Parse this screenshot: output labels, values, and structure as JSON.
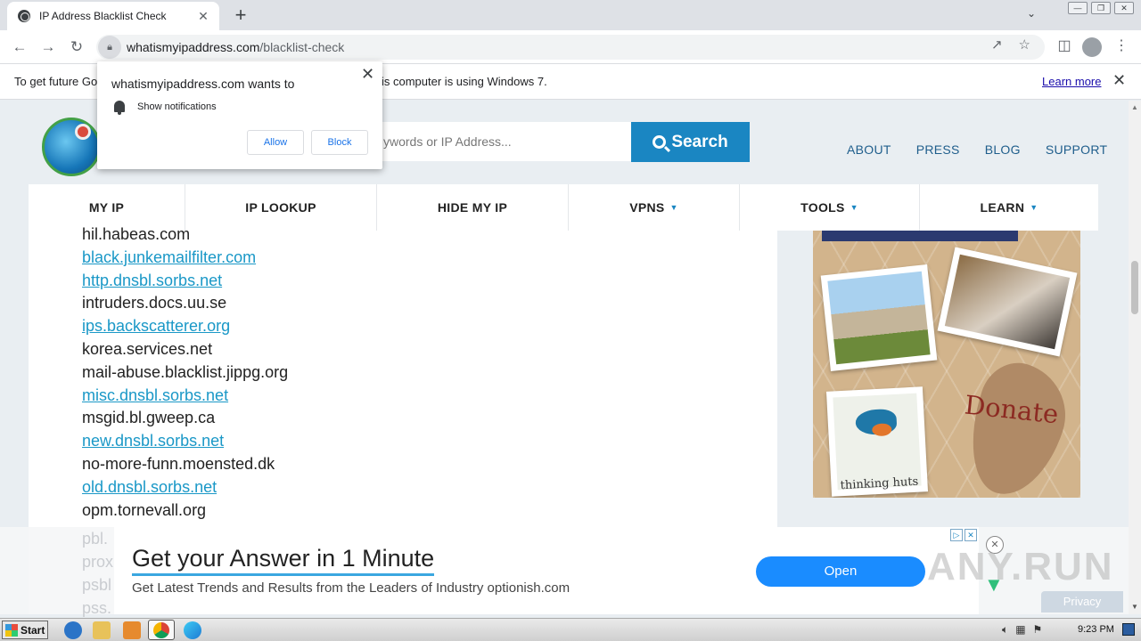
{
  "browser": {
    "tab_title": "IP Address Blacklist Check",
    "tab_close": "✕",
    "new_tab": "+",
    "url_host": "whatismyipaddress.com",
    "url_path": "/blacklist-check",
    "window_buttons": [
      "—",
      "❐",
      "✕"
    ]
  },
  "infobar": {
    "message_start": "To get future Go",
    "message_end": "is computer is using Windows 7.",
    "learn_more": "Learn more",
    "close": "✕"
  },
  "notification": {
    "origin": "whatismyipaddress.com wants to",
    "permission": "Show notifications",
    "allow": "Allow",
    "block": "Block",
    "close": "✕"
  },
  "header": {
    "search_placeholder": "ywords or IP Address...",
    "search_button": "Search",
    "top_nav": [
      "ABOUT",
      "PRESS",
      "BLOG",
      "SUPPORT"
    ]
  },
  "main_nav": [
    {
      "label": "MY IP",
      "dropdown": false
    },
    {
      "label": "IP LOOKUP",
      "dropdown": false
    },
    {
      "label": "HIDE MY IP",
      "dropdown": false
    },
    {
      "label": "VPNS",
      "dropdown": true
    },
    {
      "label": "TOOLS",
      "dropdown": true
    },
    {
      "label": "LEARN",
      "dropdown": true
    }
  ],
  "blacklists": [
    {
      "name": "hil.habeas.com",
      "link": false
    },
    {
      "name": "black.junkemailfilter.com",
      "link": true
    },
    {
      "name": "http.dnsbl.sorbs.net",
      "link": true
    },
    {
      "name": "intruders.docs.uu.se",
      "link": false
    },
    {
      "name": "ips.backscatterer.org",
      "link": true
    },
    {
      "name": "korea.services.net",
      "link": false
    },
    {
      "name": "mail-abuse.blacklist.jippg.org",
      "link": false
    },
    {
      "name": "misc.dnsbl.sorbs.net",
      "link": true
    },
    {
      "name": "msgid.bl.gweep.ca",
      "link": false
    },
    {
      "name": "new.dnsbl.sorbs.net",
      "link": true
    },
    {
      "name": "no-more-funn.moensted.dk",
      "link": false
    },
    {
      "name": "old.dnsbl.sorbs.net",
      "link": true
    },
    {
      "name": "opm.tornevall.org",
      "link": false
    }
  ],
  "faded_rows": [
    "pbl.",
    "prox",
    "psbl",
    "pss."
  ],
  "sidebar_ad": {
    "caption": "thinking huts",
    "cta": "Donate"
  },
  "bottom_ad": {
    "headline": "Get your Answer in 1 Minute",
    "subline": "Get Latest Trends and Results from the Leaders of Industry optionish.com",
    "button": "Open",
    "close": "✕"
  },
  "watermark": "ANY.RUN",
  "privacy": "Privacy",
  "taskbar": {
    "start": "Start",
    "clock": "9:23 PM"
  }
}
